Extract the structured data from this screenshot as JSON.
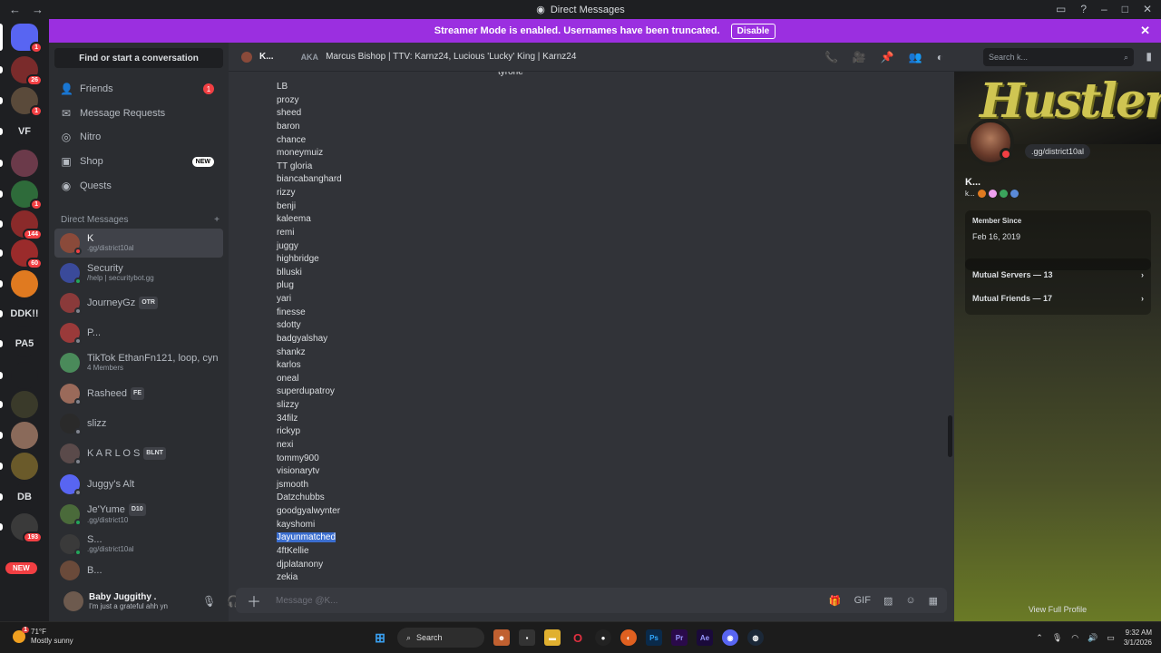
{
  "window": {
    "title": "Direct Messages"
  },
  "banner": {
    "text": "Streamer Mode is enabled. Usernames have been truncated.",
    "button": "Disable"
  },
  "rail": {
    "items": [
      {
        "name": "home",
        "label": "",
        "badge": "1",
        "color": "#5865f2"
      },
      {
        "name": "server-1",
        "label": "",
        "badge": "26",
        "color": "#7a2b2b"
      },
      {
        "name": "server-2",
        "label": "",
        "badge": "1",
        "color": "#5a4a3a"
      },
      {
        "name": "server-vf",
        "label": "VF",
        "badge": "",
        "color": "#1e1f22"
      },
      {
        "name": "server-3",
        "label": "",
        "badge": "",
        "color": "#6b3a4a"
      },
      {
        "name": "server-4",
        "label": "",
        "badge": "1",
        "color": "#2e6b3a"
      },
      {
        "name": "server-5",
        "label": "",
        "badge": "144",
        "color": "#8a2a2a"
      },
      {
        "name": "server-6",
        "label": "",
        "badge": "60",
        "color": "#9a2b2b"
      },
      {
        "name": "server-7",
        "label": "",
        "badge": "",
        "color": "#e07a20"
      },
      {
        "name": "server-ddk",
        "label": "DDK!!",
        "badge": "",
        "color": "#1e1f22"
      },
      {
        "name": "server-pa5",
        "label": "PA5",
        "badge": "",
        "color": "#1e1f22"
      },
      {
        "name": "server-folder",
        "label": "",
        "badge": "",
        "color": "#1e1f22"
      },
      {
        "name": "server-8",
        "label": "",
        "badge": "",
        "color": "#3a3a2a"
      },
      {
        "name": "server-9",
        "label": "",
        "badge": "",
        "color": "#8a6a5a"
      },
      {
        "name": "server-10",
        "label": "",
        "badge": "",
        "color": "#6a5a2a"
      },
      {
        "name": "server-db",
        "label": "DB",
        "badge": "",
        "color": "#1e1f22"
      },
      {
        "name": "server-11",
        "label": "",
        "badge": "193",
        "color": "#3a3a3a"
      }
    ],
    "new_label": "NEW"
  },
  "sidebar": {
    "find": "Find or start a conversation",
    "nav": [
      {
        "label": "Friends",
        "icon": "friends-icon",
        "glyph": "👤",
        "badge": "1"
      },
      {
        "label": "Message Requests",
        "icon": "mail-icon",
        "glyph": "✉"
      },
      {
        "label": "Nitro",
        "icon": "nitro-icon",
        "glyph": "◎"
      },
      {
        "label": "Shop",
        "icon": "shop-icon",
        "glyph": "▣",
        "tag": "NEW"
      },
      {
        "label": "Quests",
        "icon": "quests-icon",
        "glyph": "◉"
      }
    ],
    "dm_header": "Direct Messages",
    "dms": [
      {
        "name": "K",
        "sub": ".gg/district10al",
        "selected": true,
        "color": "#8a4a3a",
        "status": "#f23f43"
      },
      {
        "name": "Security",
        "sub": "/help | securitybot.gg",
        "color": "#3a4a9a",
        "status": "#23a55a"
      },
      {
        "name": "JourneyGz",
        "tag": "OTR",
        "color": "#8a3a3a",
        "status": "#80848e"
      },
      {
        "name": "P...",
        "color": "#9a3a3a",
        "status": "#80848e"
      },
      {
        "name": "TikTok EthanFn121, loop, cyn",
        "sub": "4 Members",
        "color": "#4a8a5a"
      },
      {
        "name": "Rasheed",
        "tag": "FE",
        "color": "#9a6a5a",
        "status": "#80848e"
      },
      {
        "name": "slizz",
        "color": "#2a2a2a",
        "status": "#80848e"
      },
      {
        "name": "K A R L O S",
        "tag": "BLNT",
        "color": "#5a4a4a",
        "status": "#80848e"
      },
      {
        "name": "Juggy's Alt",
        "color": "#5865f2",
        "status": "#80848e"
      },
      {
        "name": "Je'Yume",
        "tag": "D10",
        "sub": ".gg/district10",
        "color": "#4a6a3a",
        "status": "#23a55a"
      },
      {
        "name": "S...",
        "sub": ".gg/district10al",
        "color": "#3a3a3a",
        "status": "#23a55a"
      },
      {
        "name": "B...",
        "color": "#6a4a3a"
      }
    ],
    "user": {
      "name": "Baby Juggithy .",
      "status": "I'm just a grateful ahh yn"
    }
  },
  "chat": {
    "header_name": "K...",
    "aka": "AKA",
    "aka_names": "Marcus Bishop | TTV: Karnz24, Lucious 'Lucky' King | Karnz24",
    "search_placeholder": "Search k...",
    "top_text": "tyrone",
    "lines": [
      "LB",
      "prozy",
      "sheed",
      "baron",
      "chance",
      "moneymuiz",
      "TT gloria",
      "biancabanghard",
      "rizzy",
      "benji",
      "kaleema",
      "remi",
      "juggy",
      "highbridge",
      "blluski",
      "plug",
      "yari",
      "finesse",
      "sdotty",
      "badgyalshay",
      "shankz",
      "karlos",
      "oneal",
      "superdupatroy",
      "slizzy",
      "34filz",
      "rickyp",
      "nexi",
      "tommy900",
      "visionarytv",
      "jsmooth",
      "Datzchubbs",
      "goodgyalwynter",
      "kayshomi",
      "Jayunmatched",
      "4ftKellie",
      "djplatanony",
      "zekia"
    ],
    "highlighted_index": 34,
    "composer_placeholder": "Message @K..."
  },
  "profile": {
    "banner_text": "Hustlerz",
    "status": ".gg/district10al",
    "name": "K...",
    "handle": "k...",
    "member_since_label": "Member Since",
    "member_since": "Feb 16, 2019",
    "mutual_servers": "Mutual Servers — 13",
    "mutual_friends": "Mutual Friends — 17",
    "view_full": "View Full Profile"
  },
  "taskbar": {
    "temp": "71°F",
    "weather": "Mostly sunny",
    "search": "Search",
    "time": "9:32 AM",
    "date": "3/1/2026",
    "weather_badge": "1"
  }
}
